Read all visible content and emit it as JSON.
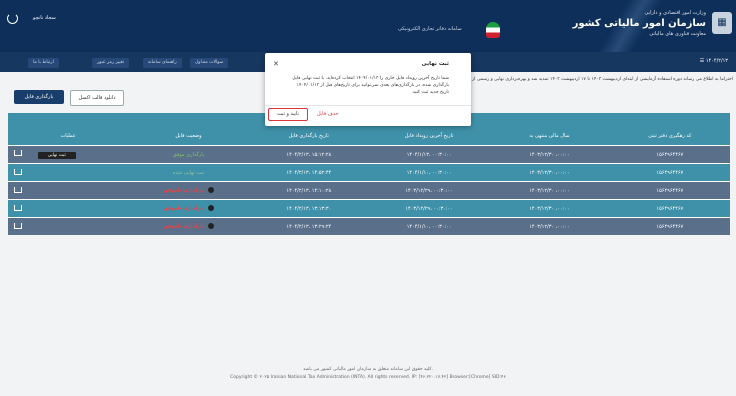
{
  "header": {
    "org_line1": "وزارت امور اقتصادی و دارایی",
    "org_line2": "سازمان امور مالیاتی کشور",
    "org_line3": "معاونت فناوری های مالیاتی",
    "system_name": "سامانه دفاتر تجاری الکترونیکی",
    "username": "سجاد نانچو"
  },
  "nav": {
    "date": "۱۴۰۴/۲/۱۳",
    "items": [
      "سوالات متداول",
      "راهنمای سامانه",
      "تغییر رمز عبور",
      "ارتباط با ما"
    ]
  },
  "notice": {
    "text": "احتراما به اطلاع می رساند دوره استفاده آزمایشی از ابتدای اردیبهشت ۱۴۰۳ تا ۱۷ اردیبهشت ۱۴۰۳ تمدید شد و بهره‌برداری نهایی و رسمی از سامانه آغاز خواهد شد."
  },
  "actions": {
    "download_template": "دانلود قالب اکسل",
    "upload_file": "بارگذاری فایل"
  },
  "table": {
    "headers": [
      "کد رهگیری دفتر ثبتی",
      "سال مالی منتهی به",
      "تاریخ آخرین رویداد فایل",
      "تاریخ بارگذاری فایل",
      "وضعیت فایل",
      "عملیات"
    ],
    "rows": [
      {
        "code": "۱۵۶۴۹۶۴۴۶۷",
        "fiscal_year": "۱۴۰۳/۱۲/۳۰ ،۰۰:۰۰",
        "last_event": "۱۴۰۴/۱/۱۳، ۰۰:۳۰:۰۰",
        "upload_date": "۱۴۰۴/۲/۱۳، ۱۵:۱۲:۲۸",
        "status": "بارگذاری موفق",
        "status_kind": "ok",
        "operation": "ثبت نهایی"
      },
      {
        "code": "۱۵۶۴۹۶۴۴۶۷",
        "fiscal_year": "۱۴۰۳/۱۲/۳۰ ،۰۰:۰۰",
        "last_event": "۱۴۰۴/۱/۱۰، ۰۰:۳۰:۰۰",
        "upload_date": "۱۴۰۴/۲/۱۳، ۱۴:۵۲:۴۴",
        "status": "ثبت نهایی شده",
        "status_kind": "dim",
        "operation": ""
      },
      {
        "code": "۱۵۶۴۹۶۴۴۶۷",
        "fiscal_year": "۱۴۰۳/۱۲/۳۰ ،۰۰:۰۰",
        "last_event": "۱۴۰۳/۱۲/۲۹، ۰۰:۳۰:۰۰",
        "upload_date": "۱۴۰۴/۲/۱۳، ۱۴:۱۰:۲۸",
        "status": "بارگذاری ناموفق",
        "status_kind": "bad",
        "operation": ""
      },
      {
        "code": "۱۵۶۴۹۶۴۴۶۷",
        "fiscal_year": "۱۴۰۳/۱۲/۳۰ ،۰۰:۰۰",
        "last_event": "۱۴۰۳/۱۲/۲۹، ۰۰:۳۰:۰۰",
        "upload_date": "۱۴۰۴/۲/۱۳، ۱۳:۱۳:۳۰",
        "status": "بارگذاری ناموفق",
        "status_kind": "bad",
        "operation": ""
      },
      {
        "code": "۱۵۶۴۹۶۴۴۶۷",
        "fiscal_year": "۱۴۰۳/۱۲/۳۰ ،۰۰:۰۰",
        "last_event": "۱۴۰۴/۱/۱۰، ۰۰:۳۰:۰۰",
        "upload_date": "۱۴۰۴/۲/۱۳، ۱۳:۲۹:۲۴",
        "status": "بارگذاری ناموفق",
        "status_kind": "bad",
        "operation": ""
      }
    ]
  },
  "modal": {
    "title": "ثبت نهایی",
    "message": "شما تاریخ آخرین رویداد فایل جاری را ۱۴۰۴/۰۱/۱۳ انتخاب کرده‌اید. با ثبت نهایی فایل بارگذاری شده، در بارگذاری‌های بعدی نمی‌توانید برای تاریخ‌های قبل از ۱۴۰۴/۰۱/۱۳ تاریخ جدید ثبت کنید.",
    "delete_label": "حذف فایل",
    "confirm_label": "تایید و ثبت"
  },
  "footer": {
    "line1": "کلیه حقوق این سامانه متعلق به سازمان امور مالیاتی کشور می باشد.",
    "line2": "Copyright © ۲۰۲۵ Iranian National Tax Administration (INTA). All rights reserved. IP: [۴۶.۲۲۰.۱۷.۴۲] Browser:[Chrome] SID:۴۶"
  },
  "colors": {
    "header": "#0d2f5a",
    "table_teal": "#3f91a9",
    "table_slate": "#5a6f8a",
    "danger": "#d9363e"
  }
}
